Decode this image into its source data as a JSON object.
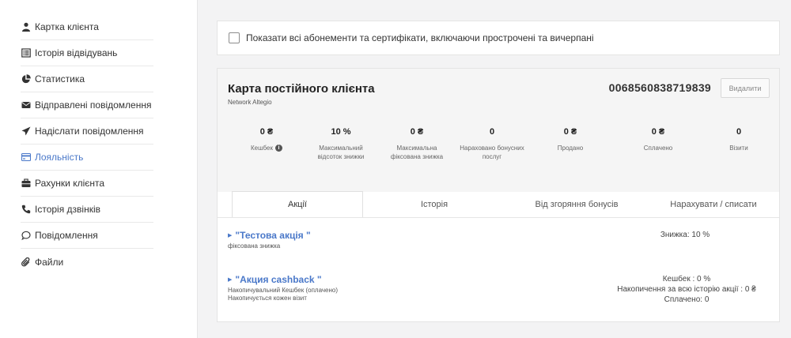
{
  "sidebar": {
    "items": [
      {
        "label": "Картка клієнта",
        "icon": "user-icon",
        "active": false
      },
      {
        "label": "Історія відвідувань",
        "icon": "list-icon",
        "active": false
      },
      {
        "label": "Статистика",
        "icon": "pie-chart-icon",
        "active": false
      },
      {
        "label": "Відправлені повідомлення",
        "icon": "envelope-icon",
        "active": false
      },
      {
        "label": "Надіслати повідомлення",
        "icon": "paper-plane-icon",
        "active": false
      },
      {
        "label": "Лояльність",
        "icon": "credit-card-icon",
        "active": true
      },
      {
        "label": "Рахунки клієнта",
        "icon": "wallet-icon",
        "active": false
      },
      {
        "label": "Історія дзвінків",
        "icon": "phone-icon",
        "active": false
      },
      {
        "label": "Повідомлення",
        "icon": "comment-icon",
        "active": false
      },
      {
        "label": "Файли",
        "icon": "paperclip-icon",
        "active": false
      }
    ]
  },
  "filter": {
    "show_all_label": "Показати всі абонементи та сертифікати, включаючи прострочені та вичерпані",
    "checked": false
  },
  "card": {
    "title": "Карта постійного клієнта",
    "subtitle": "Network Altegio",
    "number": "0068560838719839",
    "delete_label": "Видалити",
    "stats": [
      {
        "value": "0 ₴",
        "label_lines": [
          "Кешбек"
        ],
        "info": true
      },
      {
        "value": "10 %",
        "label_lines": [
          "Максимальний",
          "відсоток знижки"
        ],
        "info": false
      },
      {
        "value": "0 ₴",
        "label_lines": [
          "Максимальна",
          "фіксована знижка"
        ],
        "info": false
      },
      {
        "value": "0",
        "label_lines": [
          "Нараховано бонусних",
          "послуг"
        ],
        "info": false
      },
      {
        "value": "0 ₴",
        "label_lines": [
          "Продано"
        ],
        "info": false
      },
      {
        "value": "0 ₴",
        "label_lines": [
          "Сплачено"
        ],
        "info": false
      },
      {
        "value": "0",
        "label_lines": [
          "Візити"
        ],
        "info": false
      }
    ],
    "tabs": [
      {
        "label": "Акції",
        "active": true
      },
      {
        "label": "Історія",
        "active": false
      },
      {
        "label": "Від згоряння бонусів",
        "active": false
      },
      {
        "label": "Нарахувати / списати",
        "active": false
      }
    ],
    "promotions": [
      {
        "name": "\"Тестова акція \"",
        "desc_lines": [
          "фіксована знижка"
        ],
        "right_lines": [
          "Знижка: 10 %"
        ]
      },
      {
        "name": "\"Акция cashback \"",
        "desc_lines": [
          "Накопичувальний Кешбек (оплачено)",
          "Накопичується кожен візит"
        ],
        "right_lines": [
          "Кешбек : 0 %",
          "Накопичення за всю історію акції : 0 ₴",
          "Сплачено: 0"
        ]
      }
    ]
  }
}
